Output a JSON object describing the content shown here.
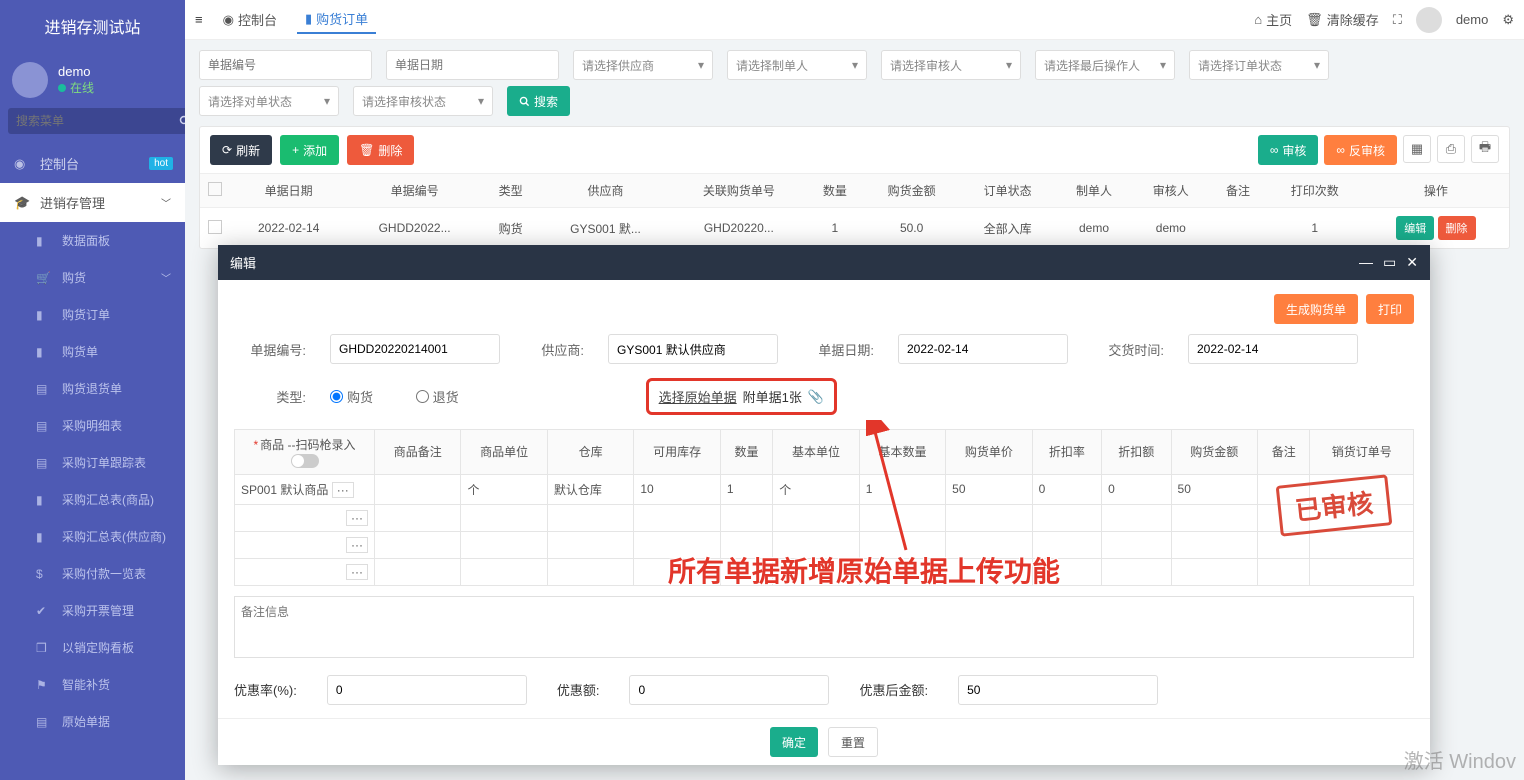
{
  "brand": "进销存测试站",
  "user": {
    "name": "demo",
    "status": "在线"
  },
  "search_placeholder": "搜索菜单",
  "nav": {
    "console": "控制台",
    "hot": "hot",
    "jxc": "进销存管理",
    "items": [
      "数据面板",
      "购货",
      "购货订单",
      "购货单",
      "购货退货单",
      "采购明细表",
      "采购订单跟踪表",
      "采购汇总表(商品)",
      "采购汇总表(供应商)",
      "采购付款一览表",
      "采购开票管理",
      "以销定购看板",
      "智能补货",
      "原始单据"
    ]
  },
  "tabs": {
    "console": "控制台",
    "order": "购货订单"
  },
  "topbar": {
    "home": "主页",
    "clear": "清除缓存",
    "user": "demo"
  },
  "filters": {
    "doc_no": "单据编号",
    "doc_date": "单据日期",
    "supplier": "请选择供应商",
    "creator": "请选择制单人",
    "auditor": "请选择审核人",
    "last_op": "请选择最后操作人",
    "order_status": "请选择订单状态",
    "match_status": "请选择对单状态",
    "audit_status": "请选择审核状态",
    "search": "搜索"
  },
  "toolbar": {
    "refresh": "刷新",
    "add": "添加",
    "delete": "删除",
    "audit": "审核",
    "unaudit": "反审核"
  },
  "columns": [
    "单据日期",
    "单据编号",
    "类型",
    "供应商",
    "关联购货单号",
    "数量",
    "购货金额",
    "订单状态",
    "制单人",
    "审核人",
    "备注",
    "打印次数",
    "操作"
  ],
  "row0": {
    "date": "2022-02-14",
    "no": "GHDD2022...",
    "type": "购货",
    "supplier": "GYS001 默...",
    "rel": "GHD20220...",
    "qty": "1",
    "amount": "50.0",
    "status": "全部入库",
    "creator": "demo",
    "auditor": "demo",
    "remark": "",
    "print": "1",
    "edit": "编辑",
    "del": "删除"
  },
  "modal": {
    "title": "编辑",
    "gen_order": "生成购货单",
    "print": "打印",
    "labels": {
      "doc_no": "单据编号:",
      "supplier": "供应商:",
      "doc_date": "单据日期:",
      "delivery": "交货时间:",
      "type": "类型:",
      "buy": "购货",
      "return": "退货",
      "select_original": "选择原始单据",
      "attachment": "附单据1张"
    },
    "values": {
      "doc_no": "GHDD20220214001",
      "supplier": "GYS001 默认供应商",
      "doc_date": "2022-02-14",
      "delivery": "2022-02-14"
    },
    "edit_cols": [
      "商品 --扫码枪录入",
      "商品备注",
      "商品单位",
      "仓库",
      "可用库存",
      "数量",
      "基本单位",
      "基本数量",
      "购货单价",
      "折扣率",
      "折扣额",
      "购货金额",
      "备注",
      "销货订单号"
    ],
    "edit_row": {
      "product": "SP001 默认商品",
      "unit": "个",
      "warehouse": "默认仓库",
      "stock": "10",
      "qty": "1",
      "base_unit": "个",
      "base_qty": "1",
      "price": "50",
      "discount_rate": "0",
      "discount_amt": "0",
      "amount": "50"
    },
    "stamp": "已审核",
    "remark_ph": "备注信息",
    "bottom": {
      "rate_label": "优惠率(%):",
      "rate": "0",
      "amt_label": "优惠额:",
      "amt": "0",
      "after_label": "优惠后金额:",
      "after": "50"
    },
    "footer": {
      "ok": "确定",
      "reset": "重置"
    }
  },
  "annotation": "所有单据新增原始单据上传功能",
  "watermark": "激活 Windov"
}
